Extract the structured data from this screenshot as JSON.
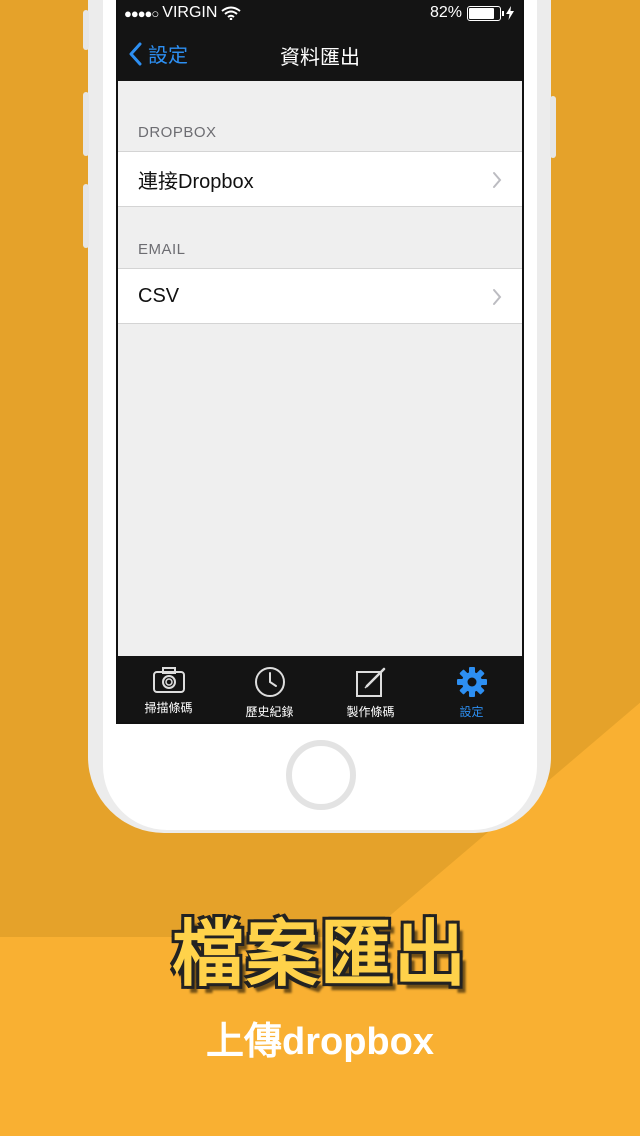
{
  "status_bar": {
    "signal": "●●●●○",
    "carrier": "VIRGIN",
    "battery": "82%"
  },
  "nav": {
    "back_label": "設定",
    "title": "資料匯出"
  },
  "sections": [
    {
      "header": "DROPBOX",
      "rows": [
        {
          "label": "連接Dropbox"
        }
      ]
    },
    {
      "header": "EMAIL",
      "rows": [
        {
          "label": "CSV"
        }
      ]
    }
  ],
  "tabs": [
    {
      "label": "掃描條碼",
      "icon": "camera-icon"
    },
    {
      "label": "歷史紀錄",
      "icon": "clock-icon"
    },
    {
      "label": "製作條碼",
      "icon": "edit-icon"
    },
    {
      "label": "設定",
      "icon": "gear-icon",
      "active": true
    }
  ],
  "promo": {
    "headline": "檔案匯出",
    "subline": "上傳dropbox"
  },
  "colors": {
    "background": "#f9b032",
    "accent": "#2d8ff2",
    "headline": "#ffd24a"
  }
}
